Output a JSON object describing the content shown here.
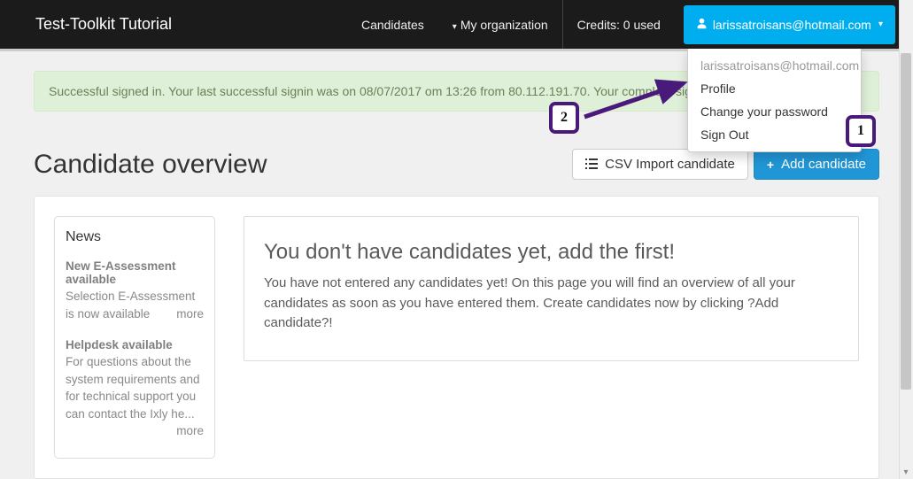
{
  "brand": "Test-Toolkit Tutorial",
  "nav": {
    "candidates": "Candidates",
    "my_org": "My organization",
    "credits": "Credits: 0 used"
  },
  "user": {
    "email": "larissatroisans@hotmail.com"
  },
  "dropdown": {
    "email": "larissatroisans@hotmail.com",
    "profile": "Profile",
    "change_pw": "Change your password",
    "sign_out": "Sign Out"
  },
  "alert": "Successful signed in. Your last successful signin was on 08/07/2017 om 13:26 from 80.112.191.70. Your complete signin history is ...",
  "page": {
    "title": "Candidate overview",
    "csv_btn": "CSV Import candidate",
    "add_btn": "Add candidate"
  },
  "news": {
    "heading": "News",
    "items": [
      {
        "title": "New E-Assessment available",
        "desc": "Selection E-Assessment is now available",
        "more": "more"
      },
      {
        "title": "Helpdesk available",
        "desc": "For questions about the system requirements and for technical support you can contact the Ixly he...",
        "more": "more"
      }
    ]
  },
  "empty": {
    "title": "You don't have candidates yet, add the first!",
    "body": "You have not entered any candidates yet! On this page you will find an overview of all your candidates as soon as you have entered them. Create candidates now by clicking ?Add candidate?!"
  },
  "annotations": {
    "one": "1",
    "two": "2"
  }
}
